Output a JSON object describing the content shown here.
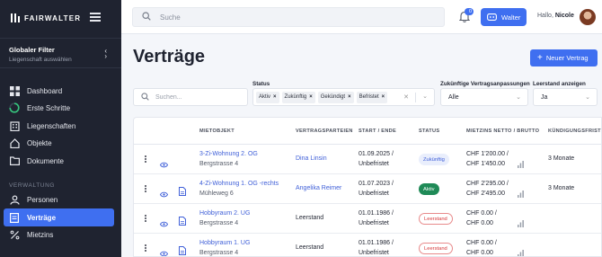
{
  "brand": {
    "name": "FAIRWALTER"
  },
  "filter": {
    "title": "Globaler Filter",
    "subtitle": "Liegenschaft auswählen"
  },
  "nav": {
    "items": [
      {
        "label": "Dashboard",
        "icon": "dashboard-icon"
      },
      {
        "label": "Erste Schritte",
        "icon": "progress-ring-icon"
      },
      {
        "label": "Liegenschaften",
        "icon": "building-icon"
      },
      {
        "label": "Objekte",
        "icon": "home-icon"
      },
      {
        "label": "Dokumente",
        "icon": "folder-icon"
      }
    ],
    "section_label": "VERWALTUNG",
    "section_items": [
      {
        "label": "Personen",
        "icon": "user-icon"
      },
      {
        "label": "Verträge",
        "icon": "contract-icon",
        "active": true
      },
      {
        "label": "Mietzins",
        "icon": "percent-icon"
      }
    ]
  },
  "topbar": {
    "search_placeholder": "Suche",
    "notifications_count": "0",
    "assistant_label": "Walter",
    "greeting": "Hallo,",
    "user_name": "Nicole"
  },
  "page": {
    "title": "Verträge",
    "new_button": "Neuer Vertrag"
  },
  "filters": {
    "search_placeholder": "Suchen...",
    "status_label": "Status",
    "status_chips": [
      "Aktiv",
      "Zukünftig",
      "Gekündigt",
      "Befristet"
    ],
    "adjustments_label": "Zukünftige Vertragsanpassungen",
    "adjustments_value": "Alle",
    "vacancy_label": "Leerstand anzeigen",
    "vacancy_value": "Ja"
  },
  "table": {
    "columns": [
      "MIETOBJEKT",
      "VERTRAGSPARTEIEN",
      "START / ENDE",
      "STATUS",
      "MIETZINS NETTO / BRUTTO",
      "KÜNDIGUNGSFRIST"
    ],
    "rows": [
      {
        "object": "3-Zi-Wohnung 2. OG",
        "address": "Bergstrasse 4",
        "party": "Dina Linsin",
        "party_link": true,
        "start": "01.09.2025 /",
        "end": "Unbefristet",
        "status": "Zukünftig",
        "status_kind": "zuk",
        "net": "CHF 1'200.00 /",
        "gross": "CHF 1'450.00",
        "notice": "3 Monate",
        "has_doc": false
      },
      {
        "object": "4-Zi-Wohnung 1. OG -rechts",
        "address": "Mühleweg 6",
        "party": "Angelika Reimer",
        "party_link": true,
        "start": "01.07.2023 /",
        "end": "Unbefristet",
        "status": "Aktiv",
        "status_kind": "aktiv",
        "net": "CHF 2'295.00 /",
        "gross": "CHF 2'495.00",
        "notice": "3 Monate",
        "has_doc": true
      },
      {
        "object": "Hobbyraum 2. UG",
        "address": "Bergstrasse 4",
        "party": "Leerstand",
        "party_link": false,
        "start": "01.01.1986 /",
        "end": "Unbefristet",
        "status": "Leerstand",
        "status_kind": "leer",
        "net": "CHF 0.00 /",
        "gross": "CHF 0.00",
        "notice": "",
        "has_doc": true
      },
      {
        "object": "Hobbyraum 1. UG",
        "address": "Bergstrasse 4",
        "party": "Leerstand",
        "party_link": false,
        "start": "01.01.1986 /",
        "end": "Unbefristet",
        "status": "Leerstand",
        "status_kind": "leer",
        "net": "CHF 0.00 /",
        "gross": "CHF 0.00",
        "notice": "",
        "has_doc": true
      }
    ]
  },
  "colors": {
    "accent": "#3f6ff0",
    "sidebar": "#1f2330",
    "active_status": "#1f8a57",
    "vacancy": "#d6383a"
  }
}
